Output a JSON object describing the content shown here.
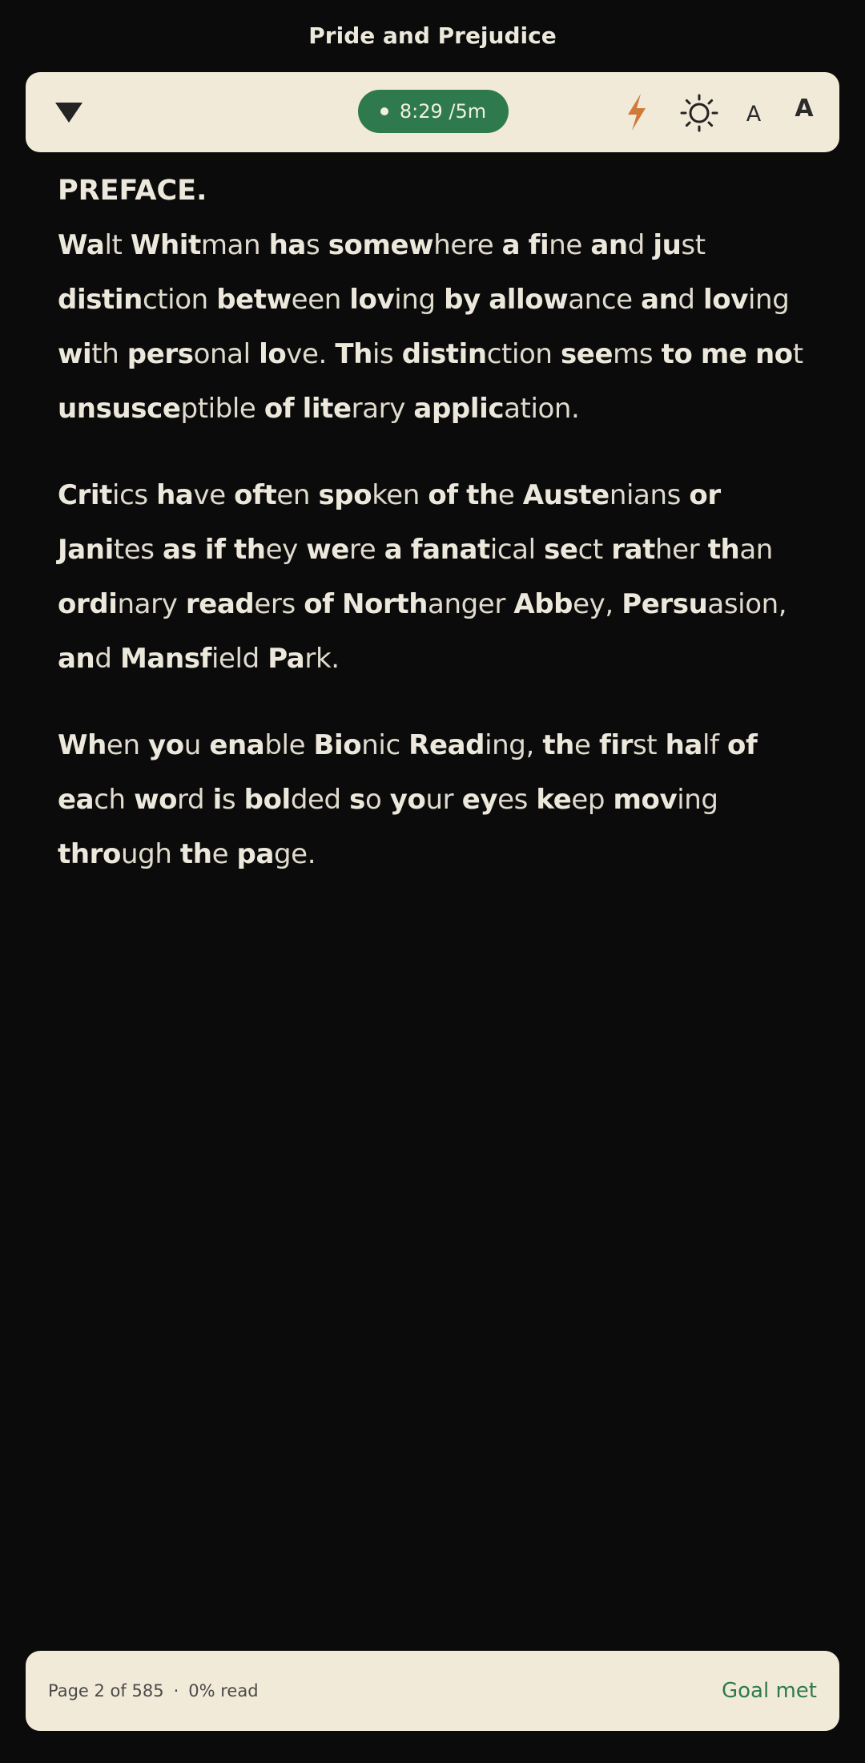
{
  "book": {
    "title": "Pride and Prejudice"
  },
  "toolbar": {
    "timer_label": "8:29 /5m",
    "icons": [
      "triangle-down-icon",
      "bolt-icon",
      "sun-icon"
    ],
    "font_small_label": "A",
    "font_large_label": "A",
    "colors": {
      "bar_bg": "#f2ead8",
      "timer_bg": "#2e7a4e",
      "bolt": "#d07a3a"
    }
  },
  "content": {
    "heading": "PREFACE.",
    "paragraphs": [
      [
        [
          "Wa",
          "lt"
        ],
        [
          "Whit",
          "man"
        ],
        [
          "ha",
          "s"
        ],
        [
          "somew",
          "here"
        ],
        [
          "a",
          ""
        ],
        [
          "fi",
          "ne"
        ],
        [
          "an",
          "d"
        ],
        [
          "ju",
          "st"
        ],
        [
          "distin",
          "ction"
        ],
        [
          "betw",
          "een"
        ],
        [
          "lov",
          "ing"
        ],
        [
          "by",
          ""
        ],
        [
          "allow",
          "ance"
        ],
        [
          "an",
          "d"
        ],
        [
          "lov",
          "ing"
        ],
        [
          "wi",
          "th"
        ],
        [
          "pers",
          "onal"
        ],
        [
          "lo",
          "ve."
        ],
        [
          "Th",
          "is"
        ],
        [
          "distin",
          "ction"
        ],
        [
          "see",
          "ms"
        ],
        [
          "to",
          ""
        ],
        [
          "me",
          ""
        ],
        [
          "no",
          "t"
        ],
        [
          "unsusce",
          "ptible"
        ],
        [
          "of",
          ""
        ],
        [
          "lite",
          "rary"
        ],
        [
          "applic",
          "ation."
        ]
      ],
      [
        [
          "Crit",
          "ics"
        ],
        [
          "ha",
          "ve"
        ],
        [
          "oft",
          "en"
        ],
        [
          "spo",
          "ken"
        ],
        [
          "of",
          ""
        ],
        [
          "th",
          "e"
        ],
        [
          "Auste",
          "nians"
        ],
        [
          "or",
          ""
        ],
        [
          "Jani",
          "tes"
        ],
        [
          "as",
          ""
        ],
        [
          "if",
          ""
        ],
        [
          "th",
          "ey"
        ],
        [
          "we",
          "re"
        ],
        [
          "a",
          ""
        ],
        [
          "fanat",
          "ical"
        ],
        [
          "se",
          "ct"
        ],
        [
          "rat",
          "her"
        ],
        [
          "th",
          "an"
        ],
        [
          "ordi",
          "nary"
        ],
        [
          "read",
          "ers"
        ],
        [
          "of",
          ""
        ],
        [
          "North",
          "anger"
        ],
        [
          "Abb",
          "ey,"
        ],
        [
          "Persu",
          "asion,"
        ],
        [
          "an",
          "d"
        ],
        [
          "Mansf",
          "ield"
        ],
        [
          "Pa",
          "rk."
        ]
      ],
      [
        [
          "Wh",
          "en"
        ],
        [
          "yo",
          "u"
        ],
        [
          "ena",
          "ble"
        ],
        [
          "Bio",
          "nic"
        ],
        [
          "Read",
          "ing,"
        ],
        [
          "th",
          "e"
        ],
        [
          "fir",
          "st"
        ],
        [
          "ha",
          "lf"
        ],
        [
          "of",
          ""
        ],
        [
          "ea",
          "ch"
        ],
        [
          "wo",
          "rd"
        ],
        [
          "i",
          "s"
        ],
        [
          "bol",
          "ded"
        ],
        [
          "s",
          "o"
        ],
        [
          "yo",
          "ur"
        ],
        [
          "ey",
          "es"
        ],
        [
          "ke",
          "ep"
        ],
        [
          "mov",
          "ing"
        ],
        [
          "thro",
          "ugh"
        ],
        [
          "th",
          "e"
        ],
        [
          "pa",
          "ge."
        ]
      ]
    ]
  },
  "footer": {
    "page_label": "Page 2 of 585",
    "separator": "·",
    "read_label": "0% read",
    "goal_label": "Goal met"
  }
}
